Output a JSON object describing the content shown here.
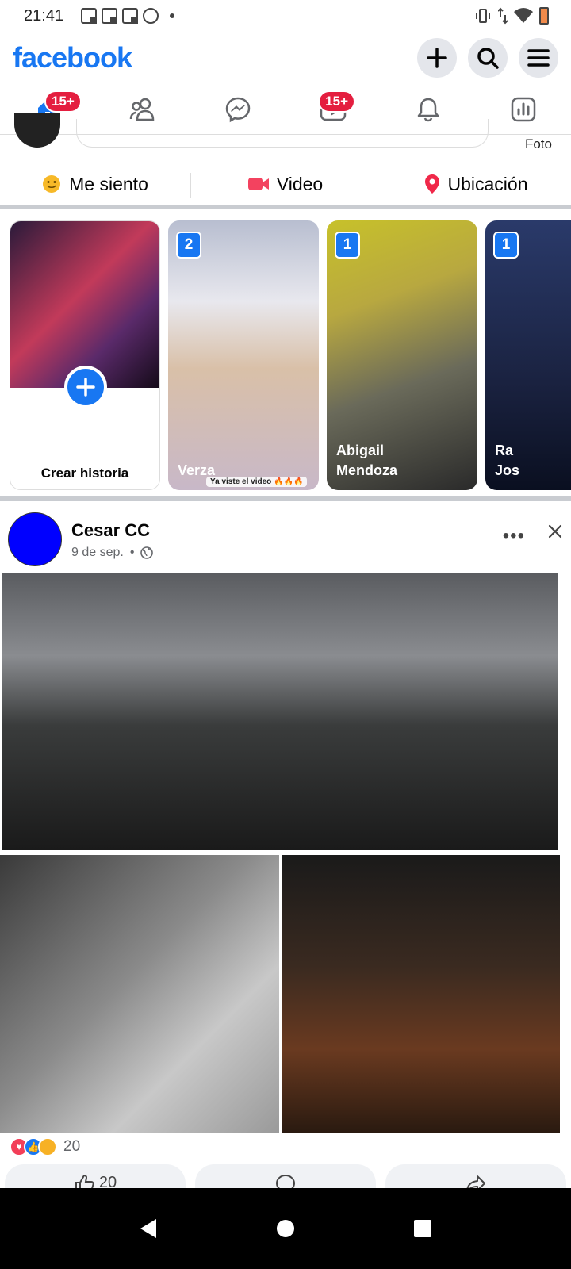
{
  "status_bar": {
    "time": "21:41"
  },
  "header": {
    "logo": "facebook"
  },
  "nav": {
    "home_badge": "15+",
    "video_badge": "15+"
  },
  "composer": {
    "foto_label": "Foto"
  },
  "actions": {
    "feeling_label": "Me siento",
    "video_label": "Video",
    "location_label": "Ubicación"
  },
  "stories": {
    "create_label": "Crear historia",
    "items": [
      {
        "count": "2",
        "name": "Verza",
        "sticker": "Ya viste el video 🔥🔥🔥"
      },
      {
        "count": "1",
        "name": "Abigail\nMendoza"
      },
      {
        "count": "1",
        "name": "Ra\nJos"
      }
    ]
  },
  "post": {
    "author": "Cesar CC",
    "date": "9 de sep.",
    "reaction_count": "20",
    "like_count": "20"
  },
  "colors": {
    "brand": "#1877f2",
    "badge": "#e41e3f",
    "avatar": "#0000ff"
  }
}
